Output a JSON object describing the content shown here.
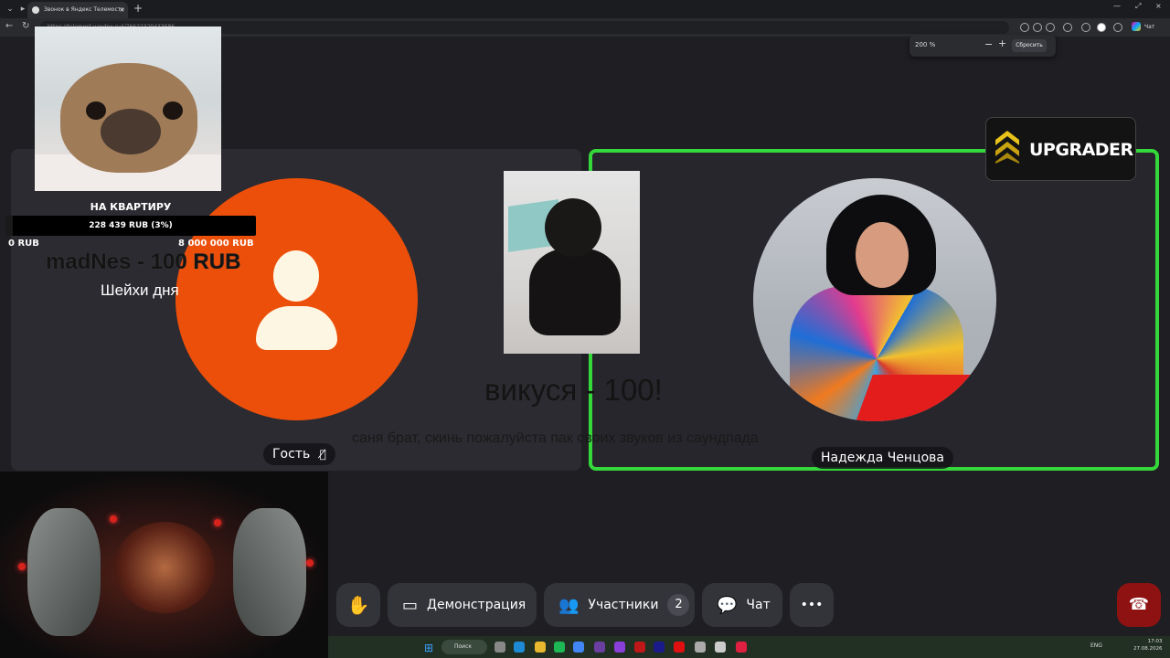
{
  "browser": {
    "tab_title": "Звонок в Яндекс Телемосте",
    "tab_close": "×",
    "newtab": "+",
    "url": "https://telemost.yandex.ru/j/76622329433686",
    "chat_label": "Чат",
    "window_controls": [
      "—",
      "⤢",
      "×"
    ]
  },
  "zoom": {
    "value": "200 %",
    "minus": "−",
    "plus": "+",
    "reset_label": "Сбросить"
  },
  "overlay": {
    "goal_title": "НА КВАРТИРУ",
    "goal_progress_text": "228 439 RUB (3%)",
    "goal_progress_fraction": 0.03,
    "goal_min": "0 RUB",
    "goal_max": "8 000 000 RUB",
    "donation_name": "madNes - 100 RUB",
    "donation_message": "Шейхи дня",
    "donation2_name": "викуся - 100!",
    "donation2_message": "саня брат, скинь пожалуйста пак своих звуков из саундпада",
    "sponsor": "UPGRADER"
  },
  "participants": [
    {
      "name": "Гость",
      "muted": true,
      "avatar_color": "#ec4f0a"
    },
    {
      "name": "Надежда Ченцова",
      "active_speaker": true,
      "border_color": "#35d83b"
    }
  ],
  "toolbar": {
    "raise_hand_icon": "hand-icon",
    "demo_label": "Демонстрация",
    "participants_label": "Участники",
    "participants_count": "2",
    "chat_label": "Чат",
    "more_label": "•••"
  },
  "taskbar": {
    "search_label": "Поиск",
    "lang": "ENG",
    "time": "17:03",
    "date": "27.08.2026"
  },
  "colors": {
    "accent_green": "#35d83b",
    "hangup_red": "#8e1212",
    "guest_orange": "#ec4f0a"
  }
}
